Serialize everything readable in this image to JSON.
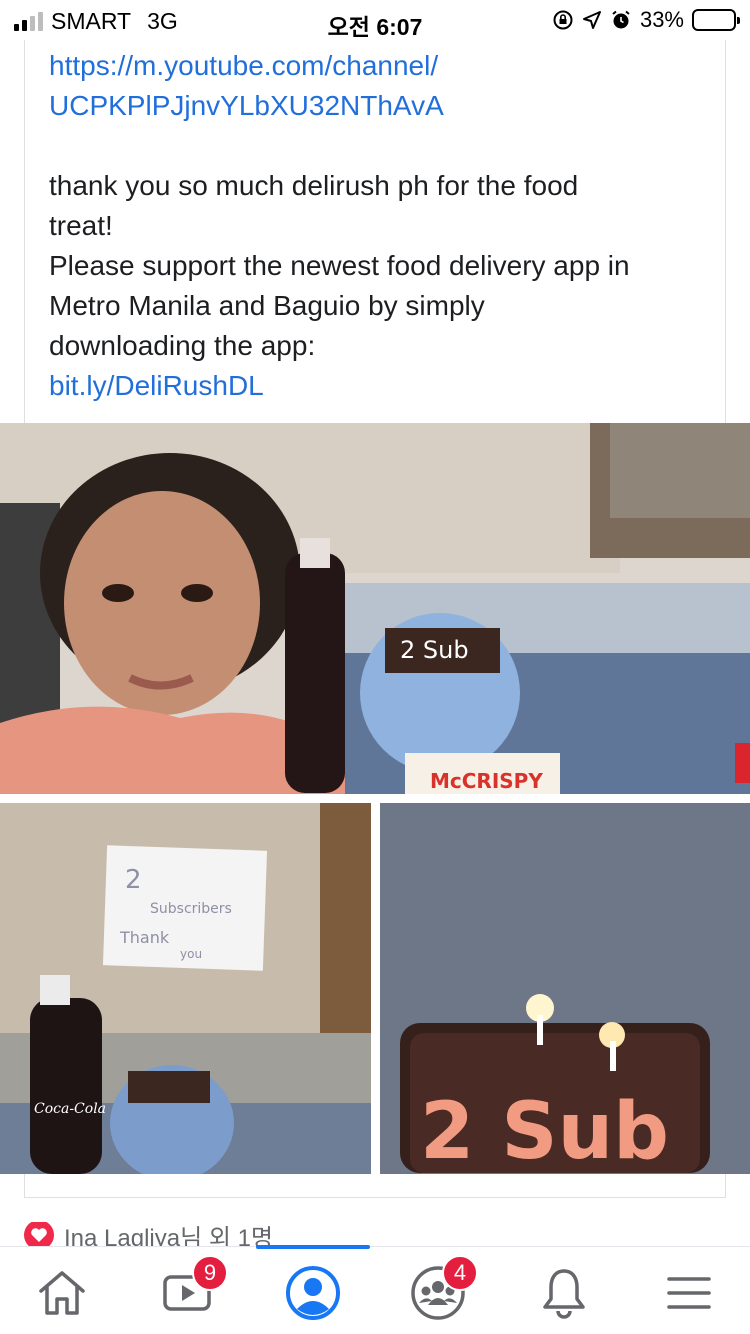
{
  "status_bar": {
    "carrier": "SMART",
    "network": "3G",
    "time": "오전 6:07",
    "battery_percent": "33%",
    "battery_level": 0.33,
    "signal_bars_active": 2,
    "icons": [
      "orientation-lock-icon",
      "location-arrow-icon",
      "alarm-icon"
    ]
  },
  "post": {
    "link_lines": [
      "https://m.youtube.com/channel/",
      "UCPKPlPJjnvYLbXU32NThAvA"
    ],
    "body_lines": [
      "thank you so much delirush ph for the food",
      "treat!",
      "Please support the newest food delivery app in",
      "Metro Manila and Baguio by simply",
      "downloading the app:"
    ],
    "download_link": "bit.ly/DeliRushDL"
  },
  "photos": {
    "main_box_text": "McCRISPY",
    "cake_text": "2 Sub",
    "note_text_lines": [
      "2",
      "Subscribers",
      "Thank",
      "you"
    ],
    "bottle_label": "Coca-Cola"
  },
  "reactions": {
    "text": "Ina Lagliya님 외 1명"
  },
  "tab_bar": {
    "tabs": [
      {
        "name": "home",
        "icon": "home-icon"
      },
      {
        "name": "watch",
        "icon": "video-icon",
        "badge": "9"
      },
      {
        "name": "profile",
        "icon": "profile-icon",
        "active": true
      },
      {
        "name": "groups",
        "icon": "groups-icon",
        "badge": "4"
      },
      {
        "name": "notifications",
        "icon": "bell-icon"
      },
      {
        "name": "menu",
        "icon": "menu-icon"
      }
    ]
  },
  "colors": {
    "link": "#216fdb",
    "accent": "#1877f2",
    "badge": "#e41e3f",
    "heart": "#f02849"
  }
}
